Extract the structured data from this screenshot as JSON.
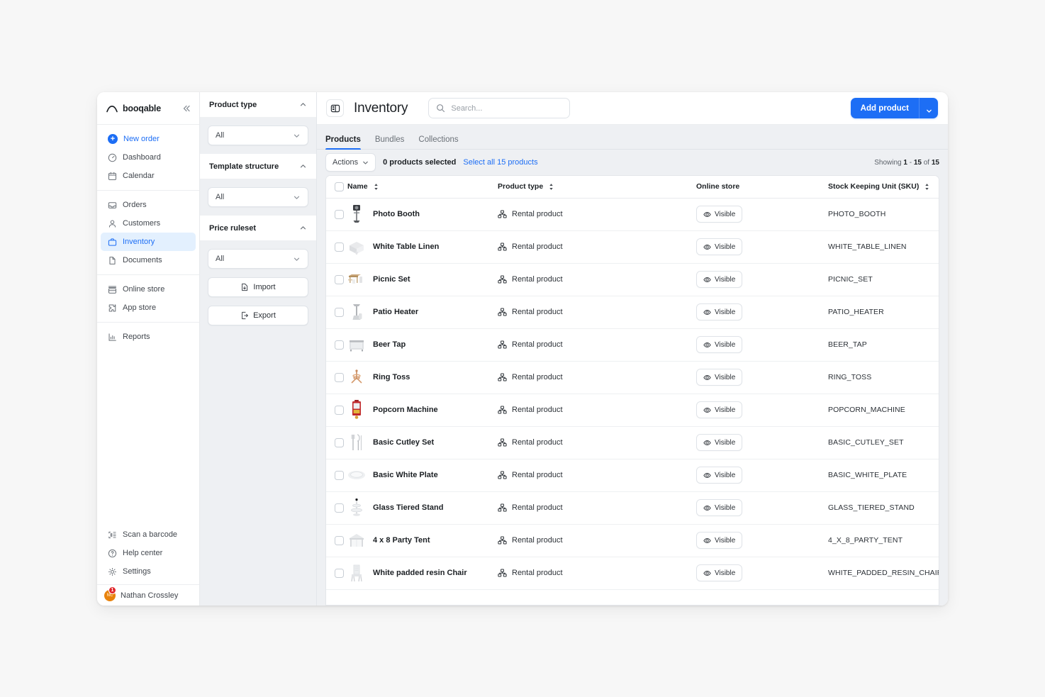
{
  "brand": {
    "name": "booqable",
    "accent": "#1d6ef5",
    "collapse_icon": "chevrons-left-icon"
  },
  "sidebar": {
    "groups": [
      {
        "items": [
          {
            "label": "New order",
            "icon": "plus-circle-icon",
            "style": "primary"
          },
          {
            "label": "Dashboard",
            "icon": "gauge-icon"
          },
          {
            "label": "Calendar",
            "icon": "calendar-icon"
          }
        ]
      },
      {
        "items": [
          {
            "label": "Orders",
            "icon": "inbox-icon"
          },
          {
            "label": "Customers",
            "icon": "user-icon"
          },
          {
            "label": "Inventory",
            "icon": "briefcase-icon",
            "active": true
          },
          {
            "label": "Documents",
            "icon": "file-icon"
          }
        ]
      },
      {
        "items": [
          {
            "label": "Online store",
            "icon": "storefront-icon"
          },
          {
            "label": "App store",
            "icon": "puzzle-icon"
          }
        ]
      },
      {
        "items": [
          {
            "label": "Reports",
            "icon": "bar-chart-icon"
          }
        ]
      }
    ],
    "bottom_items": [
      {
        "label": "Scan a barcode",
        "icon": "barcode-scan-icon"
      },
      {
        "label": "Help center",
        "icon": "question-circle-icon"
      },
      {
        "label": "Settings",
        "icon": "gear-icon"
      }
    ],
    "user": {
      "name": "Nathan Crossley",
      "initials": "NC",
      "badge_count": "1",
      "avatar_color": "#e8820c",
      "badge_color": "#e0252a"
    }
  },
  "filters": {
    "sections": [
      {
        "title": "Product type",
        "value": "All",
        "chevron": "chevron-up-icon"
      },
      {
        "title": "Template structure",
        "value": "All",
        "chevron": "chevron-up-icon"
      },
      {
        "title": "Price ruleset",
        "value": "All",
        "chevron": "chevron-up-icon"
      }
    ],
    "import_label": "Import",
    "export_label": "Export"
  },
  "header": {
    "page_icon": "panel-layout-icon",
    "title": "Inventory",
    "search_placeholder": "Search...",
    "search_value": "",
    "add_product_label": "Add product",
    "add_caret_icon": "chevron-down-icon"
  },
  "tabs": [
    {
      "label": "Products",
      "active": true
    },
    {
      "label": "Bundles",
      "active": false
    },
    {
      "label": "Collections",
      "active": false
    }
  ],
  "toolbar": {
    "actions_label": "Actions",
    "selected_text": "0 products selected",
    "select_all_link": "Select all 15 products",
    "showing_prefix": "Showing ",
    "showing_from": "1",
    "showing_dash": " - ",
    "showing_to": "15",
    "showing_of": " of ",
    "showing_total": "15"
  },
  "table": {
    "columns": [
      {
        "label": "Name",
        "sortable": true
      },
      {
        "label": "Product type",
        "sortable": true
      },
      {
        "label": "Online store",
        "sortable": false
      },
      {
        "label": "Stock Keeping Unit (SKU)",
        "sortable": true
      }
    ],
    "visible_label": "Visible",
    "rows": [
      {
        "name": "Photo Booth",
        "type": "Rental product",
        "store": "Visible",
        "sku": "PHOTO_BOOTH",
        "thumb": "photo-booth-thumb"
      },
      {
        "name": "White Table Linen",
        "type": "Rental product",
        "store": "Visible",
        "sku": "WHITE_TABLE_LINEN",
        "thumb": "table-linen-thumb"
      },
      {
        "name": "Picnic Set",
        "type": "Rental product",
        "store": "Visible",
        "sku": "PICNIC_SET",
        "thumb": "picnic-set-thumb"
      },
      {
        "name": "Patio Heater",
        "type": "Rental product",
        "store": "Visible",
        "sku": "PATIO_HEATER",
        "thumb": "patio-heater-thumb"
      },
      {
        "name": "Beer Tap",
        "type": "Rental product",
        "store": "Visible",
        "sku": "BEER_TAP",
        "thumb": "beer-tap-thumb"
      },
      {
        "name": "Ring Toss",
        "type": "Rental product",
        "store": "Visible",
        "sku": "RING_TOSS",
        "thumb": "ring-toss-thumb"
      },
      {
        "name": "Popcorn Machine",
        "type": "Rental product",
        "store": "Visible",
        "sku": "POPCORN_MACHINE",
        "thumb": "popcorn-machine-thumb"
      },
      {
        "name": "Basic Cutley Set",
        "type": "Rental product",
        "store": "Visible",
        "sku": "BASIC_CUTLEY_SET",
        "thumb": "cutlery-thumb"
      },
      {
        "name": "Basic White Plate",
        "type": "Rental product",
        "store": "Visible",
        "sku": "BASIC_WHITE_PLATE",
        "thumb": "plate-thumb"
      },
      {
        "name": "Glass Tiered Stand",
        "type": "Rental product",
        "store": "Visible",
        "sku": "GLASS_TIERED_STAND",
        "thumb": "tiered-stand-thumb"
      },
      {
        "name": "4 x 8 Party Tent",
        "type": "Rental product",
        "store": "Visible",
        "sku": "4_X_8_PARTY_TENT",
        "thumb": "party-tent-thumb"
      },
      {
        "name": "White padded resin Chair",
        "type": "Rental product",
        "store": "Visible",
        "sku": "WHITE_PADDED_RESIN_CHAIR",
        "thumb": "chair-thumb"
      }
    ]
  }
}
